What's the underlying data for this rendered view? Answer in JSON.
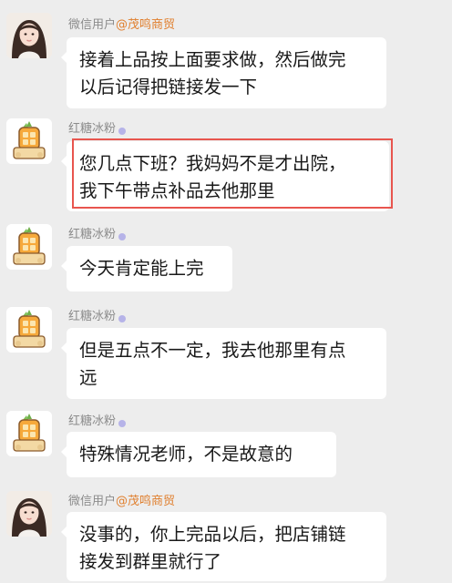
{
  "messages": [
    {
      "avatar": "girl-avatar",
      "sender_name": "微信用户",
      "sender_tag": "@茂鸣商贸",
      "text": "接着上品按上面要求做，然后做完\n以后记得把链接发一下"
    },
    {
      "avatar": "candy-avatar",
      "sender_name": "红糖冰粉",
      "sender_tag": "",
      "text": "您几点下班？我妈妈不是才出院，\n我下午带点补品去他那里",
      "highlighted": true
    },
    {
      "avatar": "candy-avatar",
      "sender_name": "红糖冰粉",
      "sender_tag": "",
      "text": "今天肯定能上完"
    },
    {
      "avatar": "candy-avatar",
      "sender_name": "红糖冰粉",
      "sender_tag": "",
      "text": "但是五点不一定，我去他那里有点\n远"
    },
    {
      "avatar": "candy-avatar",
      "sender_name": "红糖冰粉",
      "sender_tag": "",
      "text": "特殊情况老师，不是故意的"
    },
    {
      "avatar": "girl-avatar",
      "sender_name": "微信用户",
      "sender_tag": "@茂鸣商贸",
      "text": "没事的，你上完品以后，把店铺链\n接发到群里就行了"
    }
  ],
  "colors": {
    "background": "#ededed",
    "bubble": "#ffffff",
    "sender_tag": "#e07f2e",
    "highlight_border": "#e8554e"
  }
}
